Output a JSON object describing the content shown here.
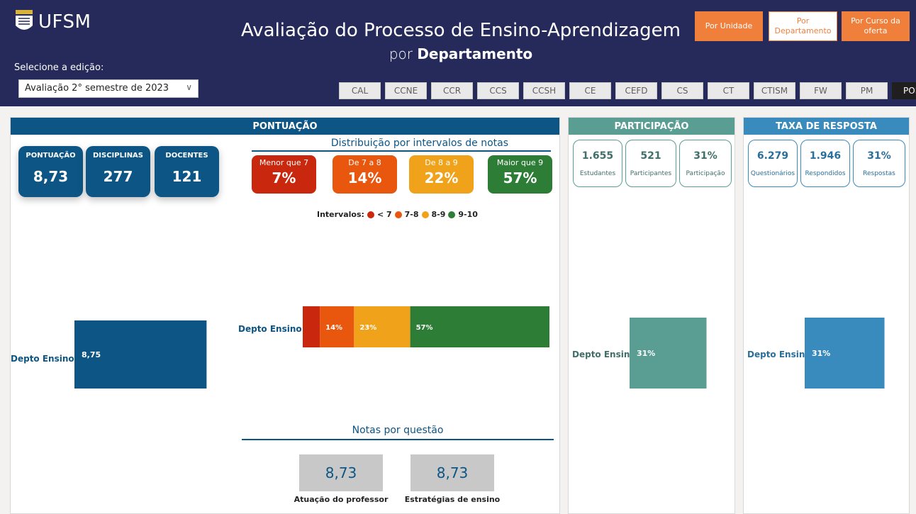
{
  "header": {
    "logo_text": "UFSM",
    "title": "Avaliação do Processo de Ensino-Aprendizagem",
    "subtitle_prefix": "por",
    "subtitle_bold": "Departamento",
    "edition_label": "Selecione a edição:",
    "edition_value": "Avaliação 2° semestre de 2023",
    "nav": {
      "por_unidade": "Por Unidade",
      "por_departamento": "Por Departamento",
      "por_curso": "Por Curso da oferta"
    },
    "dept_tabs": [
      "CAL",
      "CCNE",
      "CCR",
      "CCS",
      "CCSH",
      "CE",
      "CEFD",
      "CS",
      "CT",
      "CTISM",
      "FW",
      "PM",
      "POLI"
    ],
    "active_tab": "POLI"
  },
  "colors": {
    "navy": "#262a5a",
    "primary_blue": "#0d5584",
    "orange": "#f07f3c",
    "teal": "#5a9e93",
    "light_blue": "#3a8bbd",
    "red": "#c9280f",
    "dark_orange": "#e8570d",
    "yellow": "#f0a31a",
    "green": "#2e7d36"
  },
  "pontuacao": {
    "header": "PONTUAÇÃO",
    "kpis": [
      {
        "label": "PONTUAÇÃO",
        "value": "8,73"
      },
      {
        "label": "DISCIPLINAS",
        "value": "277"
      },
      {
        "label": "DOCENTES",
        "value": "121"
      }
    ],
    "dist_title": "Distribuição por intervalos de notas",
    "dist_cards": [
      {
        "label": "Menor que 7",
        "value": "7%"
      },
      {
        "label": "De 7 a 8",
        "value": "14%"
      },
      {
        "label": "De 8 a 9",
        "value": "22%"
      },
      {
        "label": "Maior que 9",
        "value": "57%"
      }
    ],
    "legend_title": "Intervalos:",
    "legend_items": [
      "< 7",
      "7-8",
      "8-9",
      "9-10"
    ],
    "questoes_title": "Notas por questão",
    "questoes": [
      {
        "label": "Atuação do professor",
        "value": "8,73"
      },
      {
        "label": "Estratégias de ensino",
        "value": "8,73"
      }
    ]
  },
  "participacao": {
    "header": "PARTICIPAÇÃO",
    "boxes": [
      {
        "value": "1.655",
        "label": "Estudantes"
      },
      {
        "value": "521",
        "label": "Participantes"
      },
      {
        "value": "31%",
        "label": "Participação"
      }
    ]
  },
  "taxa": {
    "header": "TAXA DE RESPOSTA",
    "boxes": [
      {
        "value": "6.279",
        "label": "Questionários"
      },
      {
        "value": "1.946",
        "label": "Respondidos"
      },
      {
        "value": "31%",
        "label": "Respostas"
      }
    ]
  },
  "chart_data": [
    {
      "type": "bar",
      "categories": [
        "Depto Ensino"
      ],
      "values": [
        8.75
      ],
      "data_labels": [
        "8,75"
      ],
      "xlim": [
        0,
        10
      ]
    },
    {
      "type": "bar",
      "stacked": true,
      "orientation": "horizontal",
      "categories": [
        "Depto Ensino"
      ],
      "series": [
        {
          "name": "< 7",
          "values": [
            7
          ],
          "label": ""
        },
        {
          "name": "7-8",
          "values": [
            14
          ],
          "label": "14%"
        },
        {
          "name": "8-9",
          "values": [
            23
          ],
          "label": "23%"
        },
        {
          "name": "9-10",
          "values": [
            57
          ],
          "label": "57%"
        }
      ],
      "xlim": [
        0,
        100
      ]
    },
    {
      "type": "bar",
      "categories": [
        "Depto Ensino"
      ],
      "values": [
        31
      ],
      "data_labels": [
        "31%"
      ],
      "xlim": [
        0,
        100
      ]
    },
    {
      "type": "bar",
      "categories": [
        "Depto Ensino"
      ],
      "values": [
        31
      ],
      "data_labels": [
        "31%"
      ],
      "xlim": [
        0,
        100
      ]
    }
  ]
}
